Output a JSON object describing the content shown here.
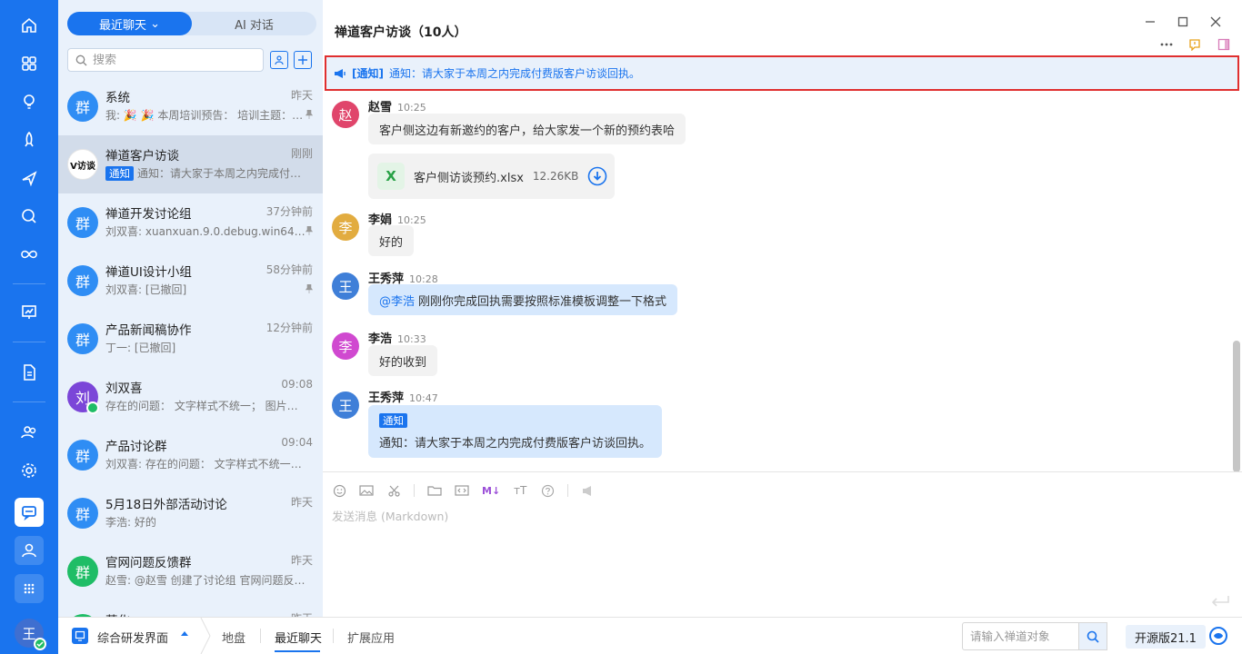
{
  "rail": {
    "items": [
      "home",
      "apps",
      "bulb",
      "rocket",
      "plane",
      "search",
      "infinity",
      "board",
      "doc",
      "contacts",
      "settings",
      "chat",
      "user",
      "grid"
    ],
    "user_avatar": "王"
  },
  "list": {
    "tab_recent": "最近聊天",
    "tab_ai": "AI 对话",
    "search_placeholder": "搜索",
    "conversations": [
      {
        "name": "系统",
        "time": "昨天",
        "preview": "我: 🎉 🎉 本周培训预告： 培训主题：…",
        "avatar": "群",
        "color": "#2f8df4",
        "pinned": true
      },
      {
        "name": "禅道客户访谈",
        "time": "刚刚",
        "tag": "通知",
        "preview": "通知：请大家于本周之内完成付费版客户访谈回执。",
        "avatar": "V访谈",
        "color": "#ffffff",
        "pinned": false
      },
      {
        "name": "禅道开发讨论组",
        "time": "37分钟前",
        "preview": "刘双喜: xuanxuan.9.0.debug.win64.zip",
        "avatar": "群",
        "color": "#2f8df4",
        "pinned": true
      },
      {
        "name": "禅道UI设计小组",
        "time": "58分钟前",
        "preview": "刘双喜: [已撤回]",
        "avatar": "群",
        "color": "#2f8df4",
        "pinned": true
      },
      {
        "name": "产品新闻稿协作",
        "time": "12分钟前",
        "preview": "丁一: [已撤回]",
        "avatar": "群",
        "color": "#2f8df4",
        "pinned": false
      },
      {
        "name": "刘双喜",
        "time": "09:08",
        "preview": "存在的问题： 文字样式不统一； 图片大…",
        "avatar": "刘",
        "color": "#7b46d8",
        "pinned": false
      },
      {
        "name": "产品讨论群",
        "time": "09:04",
        "preview": "刘双喜: 存在的问题： 文字样式不统一；…",
        "avatar": "群",
        "color": "#2f8df4",
        "pinned": false
      },
      {
        "name": "5月18日外部活动讨论",
        "time": "昨天",
        "preview": "李浩: 好的",
        "avatar": "群",
        "color": "#2f8df4",
        "pinned": false
      },
      {
        "name": "官网问题反馈群",
        "time": "昨天",
        "preview": "赵雪: @赵雪 创建了讨论组 官网问题反…",
        "avatar": "群",
        "color": "#1fbd66",
        "pinned": false
      },
      {
        "name": "营化",
        "time": "昨天",
        "preview": "",
        "avatar": "群",
        "color": "#1fbd66",
        "pinned": false
      }
    ]
  },
  "chat": {
    "title": "禅道客户访谈（10人）",
    "notice_tag": "[通知]",
    "notice_text": "通知：请大家于本周之内完成付费版客户访谈回执。",
    "messages": [
      {
        "sender": "赵雪",
        "time": "10:25",
        "avatar": "赵",
        "color": "#e0456b",
        "text": "客户侧这边有新邀约的客户，给大家发一个新的预约表哈"
      },
      {
        "file_name": "客户侧访谈预约.xlsx",
        "file_size": "12.26KB",
        "file_icon": "X"
      },
      {
        "sender": "李娟",
        "time": "10:25",
        "avatar": "李",
        "color": "#e2ac40",
        "text": "好的"
      },
      {
        "sender": "王秀萍",
        "time": "10:28",
        "avatar": "王",
        "color": "#3f7fd8",
        "mention": "@李浩",
        "text": "刚刚你完成回执需要按照标准模板调整一下格式"
      },
      {
        "sender": "李浩",
        "time": "10:33",
        "avatar": "李",
        "color": "#d049d0",
        "text": "好的收到"
      },
      {
        "sender": "王秀萍",
        "time": "10:47",
        "avatar": "王",
        "color": "#3f7fd8",
        "tag": "通知",
        "text": "通知：请大家于本周之内完成付费版客户访谈回执。"
      }
    ],
    "composer_placeholder": "发送消息 (Markdown)",
    "composer_tools": [
      "emoji",
      "image",
      "scissors",
      "folder",
      "code",
      "markdown",
      "font",
      "help",
      "megaphone"
    ],
    "md_label": "M↓"
  },
  "bottom": {
    "workspace": "综合研发界面",
    "tabs": [
      "地盘",
      "最近聊天",
      "扩展应用"
    ],
    "search_placeholder": "请输入禅道对象",
    "version": "开源版21.1"
  }
}
